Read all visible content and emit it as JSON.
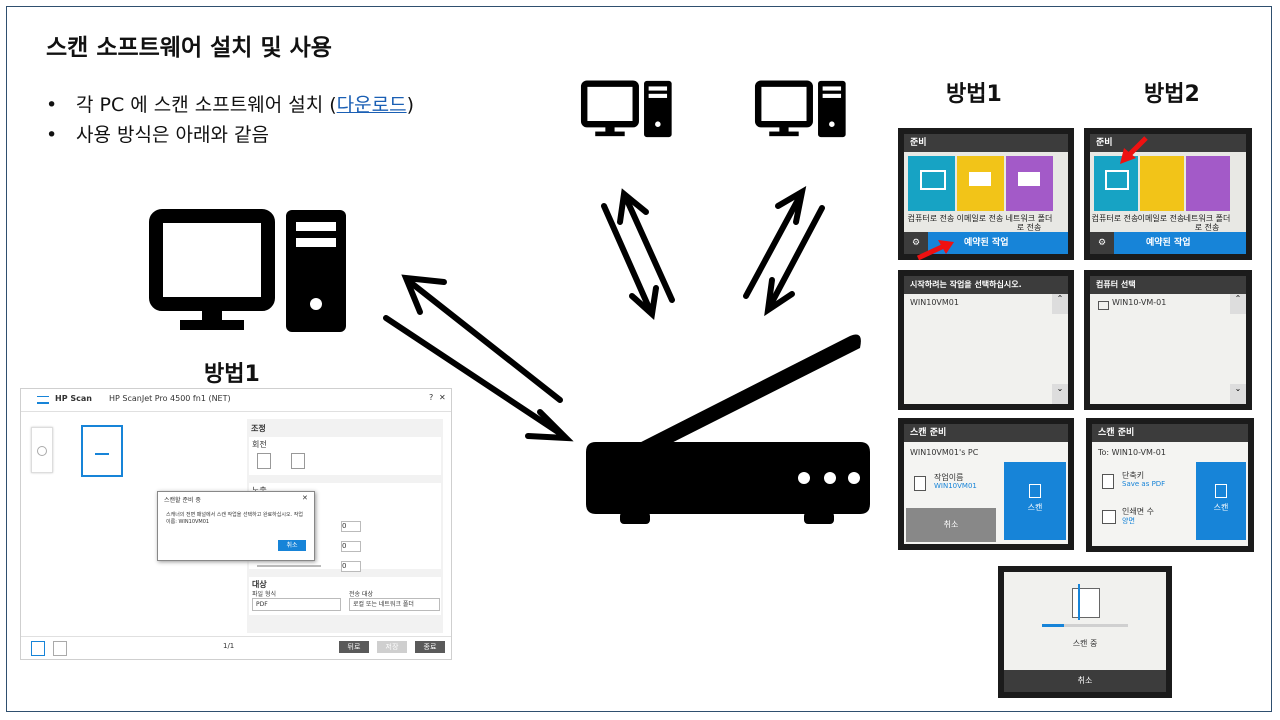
{
  "slide": {
    "title": "스캔 소프트웨어 설치 및 사용",
    "bullet1_prefix": "각 PC 에 스캔 소프트웨어 설치 (",
    "bullet1_link": "다운로드",
    "bullet1_suffix": ")",
    "bullet2": "사용 방식은 아래와 같음",
    "bullet_char": "•",
    "method1_label": "방법1",
    "method2_label": "방법2",
    "left_method_label": "방법1"
  },
  "hp_scan": {
    "app_name": "HP Scan",
    "device": "HP ScanJet Pro 4500 fn1 (NET)",
    "help": "?",
    "close": "✕",
    "panel_title": "조정",
    "rotate_label": "회전",
    "exposure_label": "노출",
    "dest_label": "대상",
    "file_type_label": "파일 형식",
    "file_type_value": "PDF",
    "send_to_label": "전송 대상",
    "send_to_value": "로컬 또는 네트워크 폴더",
    "spin_values": [
      "0",
      "0",
      "0"
    ],
    "page_count": "1/1",
    "btn_back": "뒤로",
    "btn_save": "저장",
    "btn_done": "종료",
    "dialog_title": "스캔할 준비 중",
    "dialog_text": "스캐너의 전면 패널에서 스캔 작업을 선택하고 완료하십시오. 작업 이름: WIN10VM01",
    "dialog_cancel": "취소"
  },
  "printer_screens": {
    "home_title": "준비",
    "tile1": "컴퓨터로 전송",
    "tile2": "이메일로 전송",
    "tile3": "네트워크 폴더로 전송",
    "scheduled_job": "예약된 작업",
    "job_select_title": "시작하려는 작업을 선택하십시오.",
    "job_item": "WIN10VM01",
    "pc_select_title": "컴퓨터 선택",
    "pc_item": "WIN10-VM-01",
    "ready_title": "스캔 준비",
    "m1_target": "WIN10VM01's PC",
    "m1_job_name_label": "작업이름",
    "m1_job_name_value": "WIN10VM01",
    "m1_cancel": "취소",
    "scan_btn": "스캔",
    "m2_target": "To: WIN10-VM-01",
    "m2_shortcut_label": "단축키",
    "m2_shortcut_value": "Save as PDF",
    "m2_copies_label": "인쇄면 수",
    "m2_copies_value": "양면",
    "scanning": "스캔 중",
    "scanning_cancel": "취소"
  },
  "colors": {
    "link": "#1a5fb4",
    "printer_blue": "#1784d8",
    "tile_teal": "#17a3c4",
    "tile_yellow": "#f2c418",
    "tile_purple": "#a35ac8",
    "hp_primary": "#5a5a5a"
  }
}
